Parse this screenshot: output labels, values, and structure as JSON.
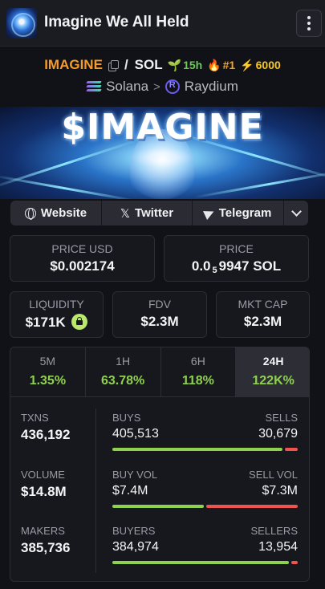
{
  "header": {
    "title": "Imagine We All Held",
    "logo_icon": "brain-logo-icon",
    "menu_icon": "vertical-dots-icon"
  },
  "pair": {
    "base": "IMAGINE",
    "separator": "/",
    "quote": "SOL",
    "age": "15h",
    "rank": "#1",
    "boosts": "6000"
  },
  "chain": {
    "network": "Solana",
    "separator": ">",
    "dex": "Raydium"
  },
  "banner": {
    "title": "$IMAGINE"
  },
  "social": {
    "website": "Website",
    "twitter": "Twitter",
    "telegram": "Telegram"
  },
  "price_usd": {
    "label": "PRICE USD",
    "value": "$0.002174"
  },
  "price_native": {
    "label": "PRICE",
    "prefix": "0.0",
    "zeros": "5",
    "digits": "9947",
    "unit": "SOL"
  },
  "liquidity": {
    "label": "LIQUIDITY",
    "value": "$171K"
  },
  "fdv": {
    "label": "FDV",
    "value": "$2.3M"
  },
  "mkt_cap": {
    "label": "MKT CAP",
    "value": "$2.3M"
  },
  "tabs": [
    {
      "label": "5M",
      "value": "1.35%"
    },
    {
      "label": "1H",
      "value": "63.78%"
    },
    {
      "label": "6H",
      "value": "118%"
    },
    {
      "label": "24H",
      "value": "122K%"
    }
  ],
  "active_tab": "24H",
  "metrics": {
    "txns": {
      "label": "TXNS",
      "value": "436,192"
    },
    "volume": {
      "label": "VOLUME",
      "value": "$14.8M"
    },
    "makers": {
      "label": "MAKERS",
      "value": "385,736"
    }
  },
  "ratios": {
    "txns": {
      "left_label": "BUYS",
      "right_label": "SELLS",
      "left_value": "405,513",
      "right_value": "30,679",
      "buy_fraction": 0.93
    },
    "volume": {
      "left_label": "BUY VOL",
      "right_label": "SELL VOL",
      "left_value": "$7.4M",
      "right_value": "$7.3M",
      "buy_fraction": 0.5
    },
    "makers": {
      "left_label": "BUYERS",
      "right_label": "SELLERS",
      "left_value": "384,974",
      "right_value": "13,954",
      "buy_fraction": 0.965
    }
  },
  "colors": {
    "accent_orange": "#f59b2a",
    "positive_green": "#8fd14f",
    "negative_red": "#ef5350",
    "background": "#111217"
  }
}
